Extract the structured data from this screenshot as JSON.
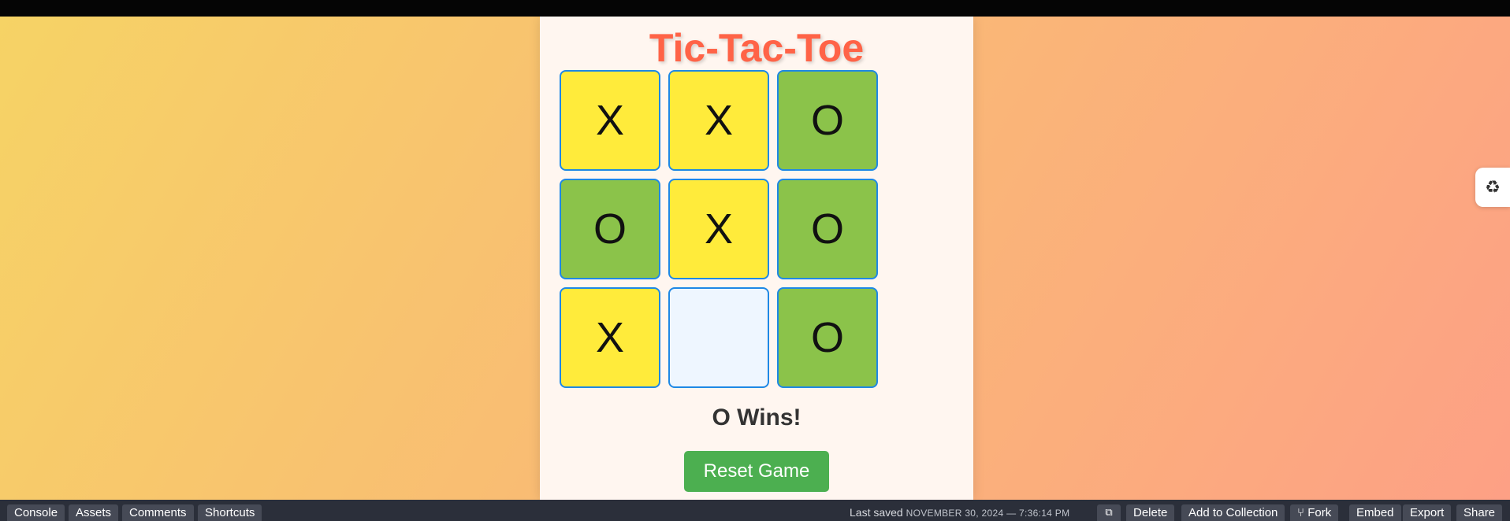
{
  "game": {
    "title": "Tic-Tac-Toe",
    "board": [
      "X",
      "X",
      "O",
      "O",
      "X",
      "O",
      "X",
      "",
      "O"
    ],
    "status": "O Wins!",
    "reset_label": "Reset Game"
  },
  "colors": {
    "x_cell": "#ffeb3b",
    "o_cell": "#8bc34a",
    "empty_cell": "#eef6ff",
    "title": "#ff6347",
    "reset_button": "#4caf50"
  },
  "side_tab": {
    "icon": "recycle-icon"
  },
  "bottom_bar": {
    "left_tabs": [
      "Console",
      "Assets",
      "Comments",
      "Shortcuts"
    ],
    "saved_label": "Last saved",
    "saved_date": "NOVEMBER 30, 2024 — 7:36:14 PM",
    "external_icon": "external-link-icon",
    "actions": {
      "delete": "Delete",
      "add_to_collection": "Add to Collection",
      "fork": "Fork",
      "embed": "Embed",
      "export": "Export",
      "share": "Share"
    }
  }
}
